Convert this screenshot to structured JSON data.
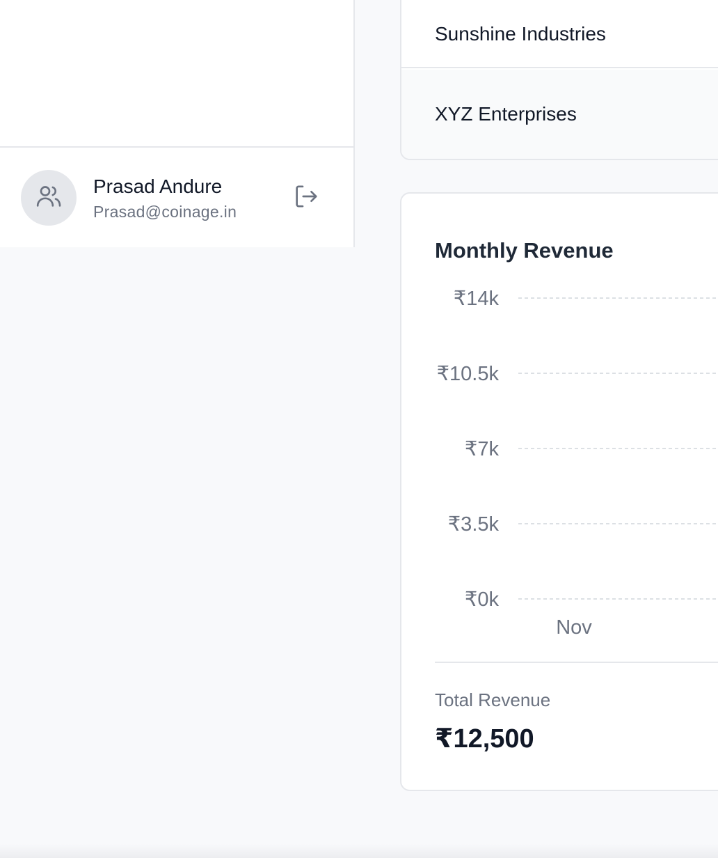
{
  "sidebar": {
    "user": {
      "name": "Prasad Andure",
      "email": "Prasad@coinage.in",
      "avatar_icon": "users-icon"
    },
    "logout_icon": "logout-icon"
  },
  "clients": [
    {
      "name": "Sunshine Industries"
    },
    {
      "name": "XYZ Enterprises"
    }
  ],
  "revenue": {
    "title": "Monthly Revenue",
    "total_label": "Total Revenue",
    "total_value": "₹12,500"
  },
  "chart_data": {
    "type": "bar",
    "title": "Monthly Revenue",
    "categories": [
      "Nov"
    ],
    "y_ticks": [
      "₹14k",
      "₹10.5k",
      "₹7k",
      "₹3.5k",
      "₹0k"
    ],
    "ylim": [
      0,
      14000
    ],
    "grid": true,
    "colors": {
      "grid": "#d1d5db",
      "tick": "#6b7280"
    }
  }
}
